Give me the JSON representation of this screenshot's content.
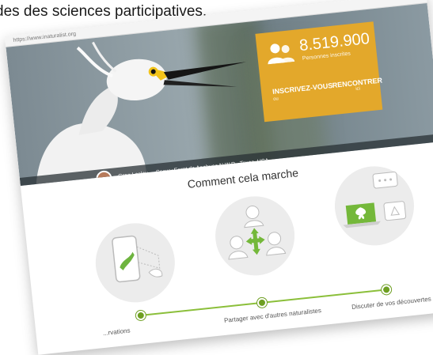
{
  "caption": {
    "text": "des des sciences participatives."
  },
  "browser": {
    "url": "https://www.inaturalist.org"
  },
  "hero": {
    "stats": {
      "count": "8.519.900",
      "count_label": "Personnes inscrites",
      "signup_label": "INSCRIVEZ-VOUS",
      "signup_sub": "ou",
      "meet_label": "RENCONTRER",
      "meet_sub": "ici"
    },
    "credit": {
      "name": "Greg Lasley",
      "separator": "–",
      "text": "Snowy Egret de Anahuac N.W.R., Texas, USA"
    }
  },
  "how_it_works": {
    "title": "Comment cela marche",
    "steps": [
      {
        "label": "...rvations",
        "icon": "phone-caterpillar-icon"
      },
      {
        "label": "Partager avec d'autres naturalistes",
        "icon": "people-share-icon"
      },
      {
        "label": "Discuter de vos découvertes",
        "icon": "laptop-chat-icon"
      }
    ]
  },
  "colors": {
    "accent_orange": "#e3a82b",
    "accent_green": "#8bbf3a"
  }
}
